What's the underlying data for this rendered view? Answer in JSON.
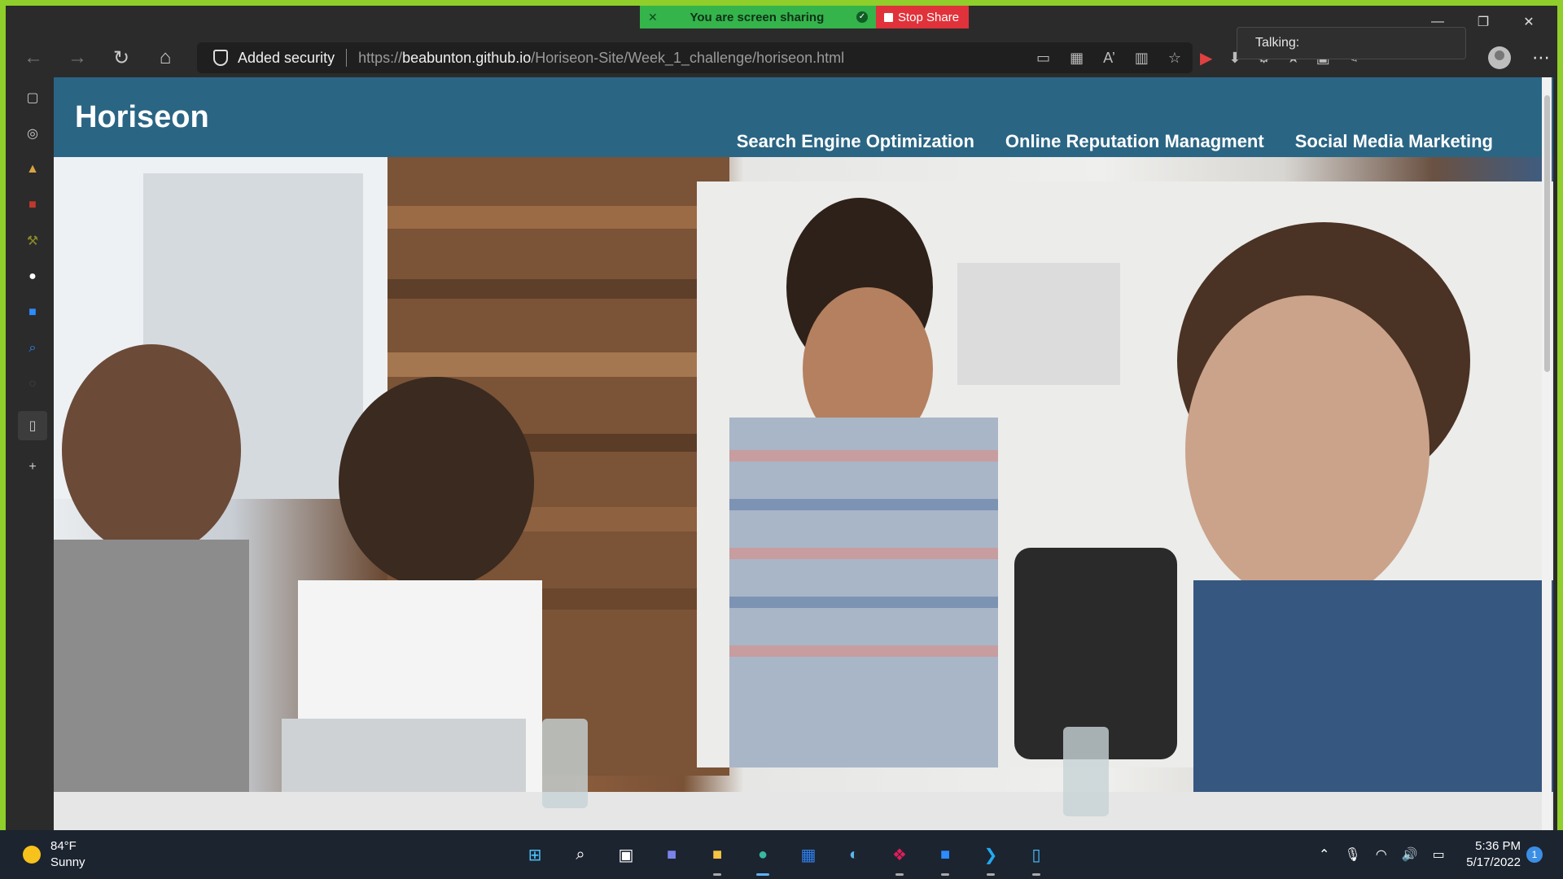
{
  "share_bar": {
    "status": "You are screen sharing",
    "stop": "Stop Share",
    "status_color": "#34b44a",
    "stop_color": "#e0323a"
  },
  "talking": {
    "label": "Talking:"
  },
  "browser": {
    "security_label": "Added security",
    "url_prefix": "https://",
    "url_host": "beabunton.github.io",
    "url_path": "/Horiseon-Site/Week_1_challenge/horiseon.html"
  },
  "site": {
    "logo": "Horiseon",
    "header_color": "#2a6584",
    "nav": [
      "Search Engine Optimization",
      "Online Reputation Managment",
      "Social Media Marketing"
    ]
  },
  "taskbar": {
    "temperature": "84°F",
    "condition": "Sunny",
    "time": "5:36 PM",
    "date": "5/17/2022",
    "notification_count": "1"
  }
}
